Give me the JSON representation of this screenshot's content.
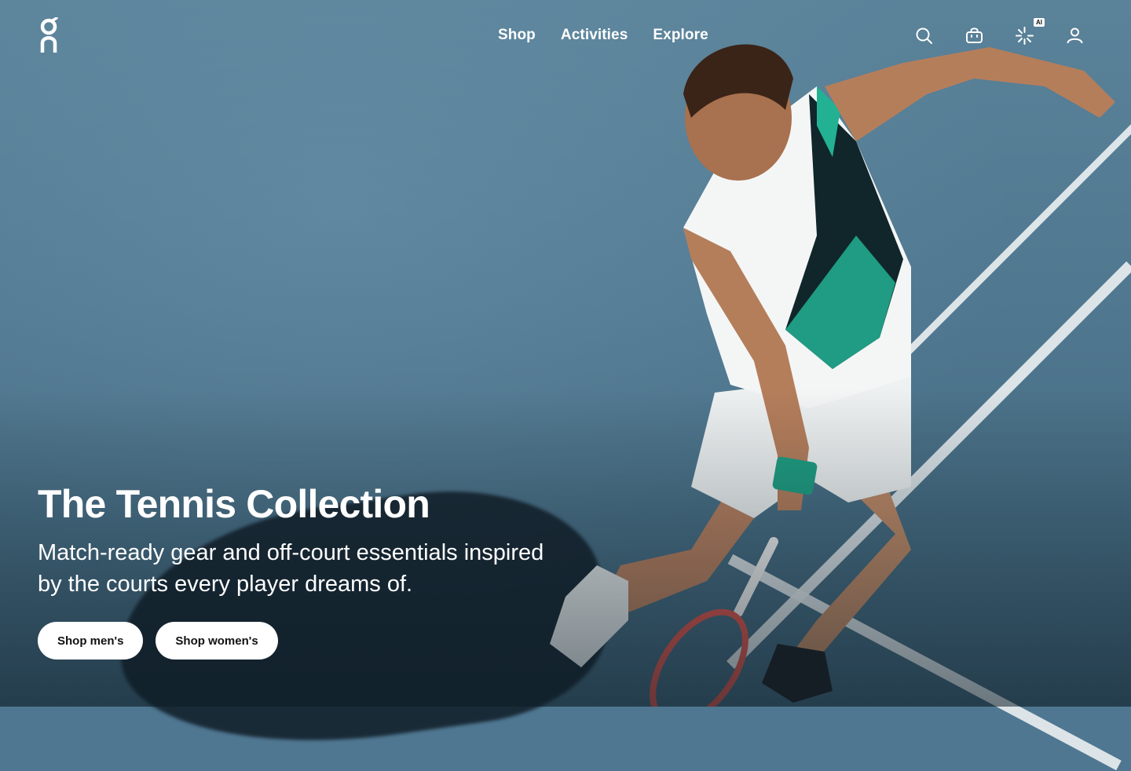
{
  "brand": {
    "logo_icon": "on-logo-icon"
  },
  "nav": {
    "items": [
      {
        "label": "Shop"
      },
      {
        "label": "Activities"
      },
      {
        "label": "Explore"
      }
    ]
  },
  "header_icons": {
    "search": "search-icon",
    "bag": "shopping-bag-icon",
    "ai": "ai-sparkle-icon",
    "ai_badge": "AI",
    "account": "account-icon"
  },
  "hero": {
    "title": "The Tennis Collection",
    "subtitle": "Match-ready gear and off-court essentials inspired by the courts every player dreams of.",
    "buttons": [
      {
        "label": "Shop men's"
      },
      {
        "label": "Shop women's"
      }
    ]
  },
  "colors": {
    "court": "#4f7791",
    "line": "#e8eef0",
    "accent_green": "#1fae8c",
    "button_bg": "#ffffff",
    "button_text": "#111111"
  }
}
